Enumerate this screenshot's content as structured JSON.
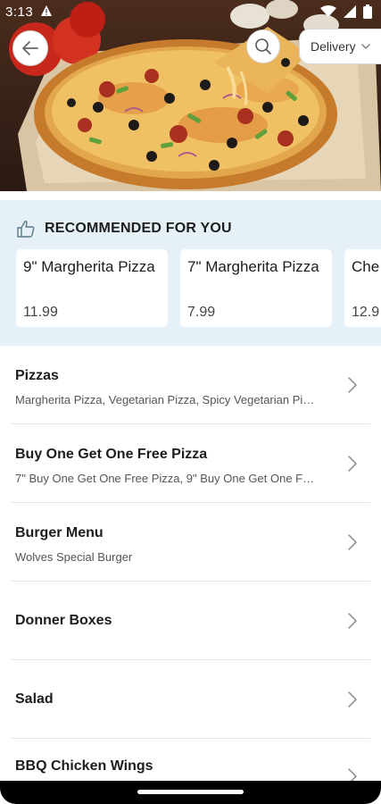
{
  "status_bar": {
    "time": "3:13"
  },
  "header": {
    "delivery_label": "Delivery"
  },
  "recommended": {
    "title": "RECOMMENDED FOR YOU",
    "items": [
      {
        "name": "9\" Margherita Pizza",
        "price": "11.99"
      },
      {
        "name": "7\" Margherita Pizza",
        "price": "7.99"
      },
      {
        "name": "Che",
        "price": "12.9"
      }
    ]
  },
  "categories": [
    {
      "name": "Pizzas",
      "subtitle": "Margherita Pizza, Vegetarian Pizza, Spicy Vegetarian Pi…"
    },
    {
      "name": "Buy One Get One Free Pizza",
      "subtitle": "7\" Buy One Get One Free Pizza, 9\" Buy One Get One F…"
    },
    {
      "name": "Burger Menu",
      "subtitle": "Wolves Special Burger"
    },
    {
      "name": "Donner Boxes",
      "subtitle": ""
    },
    {
      "name": "Salad",
      "subtitle": ""
    },
    {
      "name": "BBQ Chicken Wings",
      "subtitle": ""
    }
  ],
  "icons": {
    "back": "arrow-left-icon",
    "search": "search-icon",
    "dropdown": "chevron-down-icon",
    "recommended": "thumbs-up-icon",
    "row": "chevron-right-icon"
  },
  "colors": {
    "recommended_bg": "#e5f1f7",
    "card_bg": "#ffffff",
    "divider": "#e6e6e6"
  }
}
